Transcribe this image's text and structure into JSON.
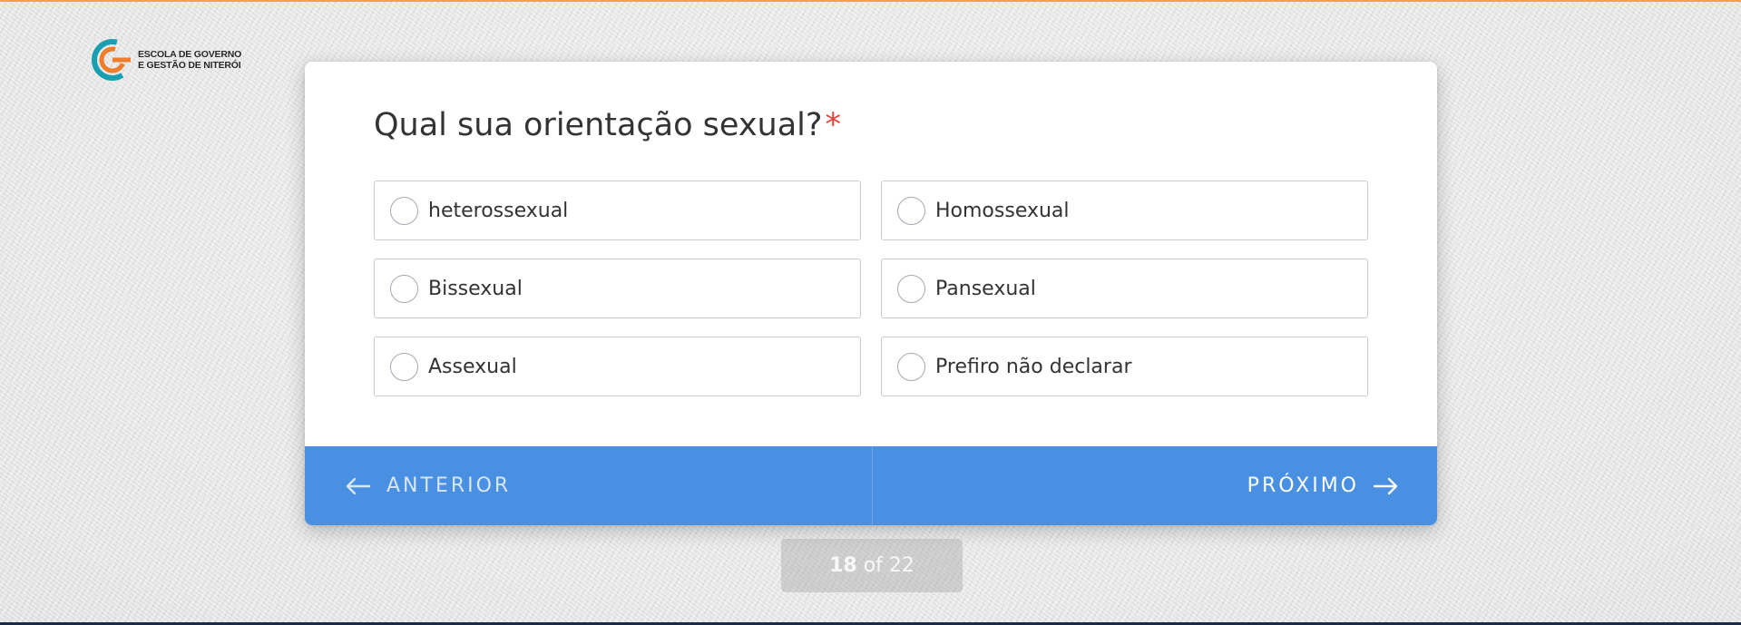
{
  "logo": {
    "line1": "ESCOLA DE GOVERNO",
    "line2": "E GESTÃO DE NITERÓI",
    "colors": {
      "teal": "#1a9fb0",
      "orange": "#f07d2a"
    }
  },
  "question": {
    "text": "Qual sua orientação sexual?",
    "required_marker": "*"
  },
  "options": [
    {
      "label": "heterossexual",
      "selected": false
    },
    {
      "label": "Homossexual",
      "selected": false
    },
    {
      "label": "Bissexual",
      "selected": false
    },
    {
      "label": "Pansexual",
      "selected": false
    },
    {
      "label": "Assexual",
      "selected": false
    },
    {
      "label": "Prefiro não declarar",
      "selected": false
    }
  ],
  "navigation": {
    "prev_label": "ANTERIOR",
    "next_label": "PRÓXIMO",
    "prev_icon": "arrow-left-icon",
    "next_icon": "arrow-right-icon"
  },
  "pagination": {
    "current": "18",
    "separator": "of",
    "total": "22"
  },
  "colors": {
    "accent": "#4a90e2",
    "required": "#e8413c",
    "text": "#333333",
    "option_border": "#c9cad3"
  }
}
